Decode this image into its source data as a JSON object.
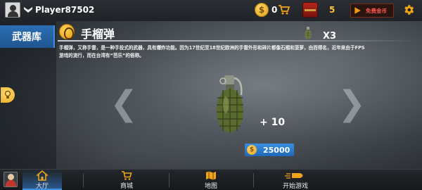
{
  "topbar": {
    "player_name": "Player87502",
    "coin_symbol": "$",
    "coin_count": "0",
    "chest_count": "5",
    "free_coin_label": "免费金币"
  },
  "sidebar": {
    "armory_label": "武器库"
  },
  "weapon": {
    "title": "手榴弹",
    "quantity": "X3",
    "description": "手榴弹，又称手雷，是一种手投式的武器，具有爆炸功能。因为17世纪至18世纪欧洲的手雷外形和碎片都像石榴和菠萝，由而得名，近年来由于FPS游戏的流行，而在台湾有“芭乐”的俗称。",
    "reward": "+ 10",
    "price": "25000",
    "price_symbol": "$"
  },
  "carousel": {
    "prev_glyph": "❮",
    "next_glyph": "❯"
  },
  "bottom_nav": {
    "items": [
      {
        "label": "大厅",
        "icon": "home-icon",
        "active": true
      },
      {
        "label": "商城",
        "icon": "cart-icon",
        "active": false
      },
      {
        "label": "地图",
        "icon": "map-icon",
        "active": false
      },
      {
        "label": "开始游戏",
        "icon": "bullet-icon",
        "active": false
      }
    ]
  },
  "colors": {
    "accent_blue": "#2c6fb3",
    "gold": "#e0a11c",
    "free_coin_red": "#ff5a4f",
    "chest_count_yellow": "#ffc23a"
  }
}
